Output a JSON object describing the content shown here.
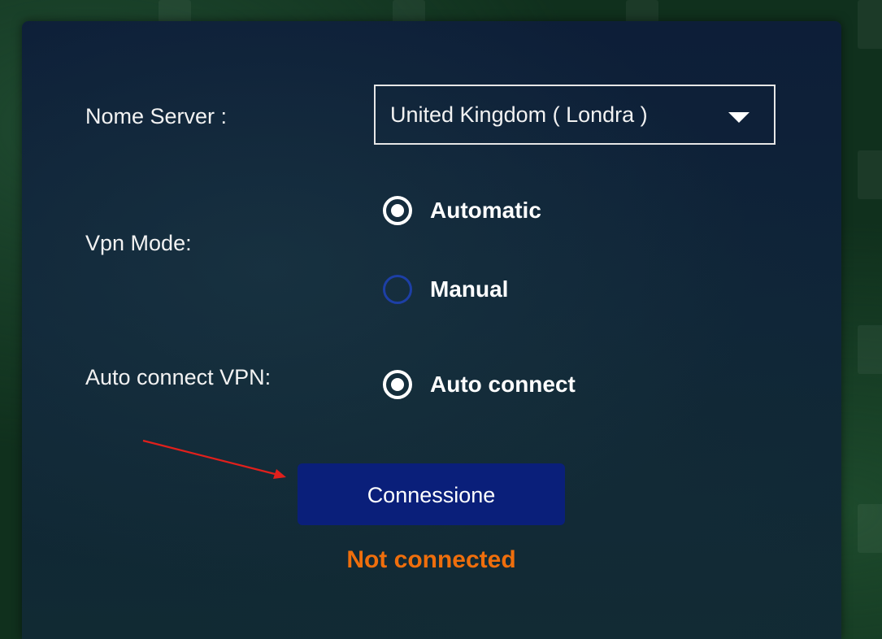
{
  "settings": {
    "server": {
      "label": "Nome Server :",
      "selected_value": "United Kingdom ( Londra )",
      "dropdown_icon": "caret-down-icon"
    },
    "vpn_mode": {
      "label": "Vpn Mode:",
      "options": [
        {
          "label": "Automatic",
          "checked": true
        },
        {
          "label": "Manual",
          "checked": false
        }
      ]
    },
    "auto_connect": {
      "label": "Auto connect VPN:",
      "option": {
        "label": "Auto connect",
        "checked": true
      }
    }
  },
  "actions": {
    "connect_label": "Connessione"
  },
  "status": {
    "text": "Not connected",
    "color": "#ef6e0c"
  },
  "colors": {
    "button_bg": "#0a1f7a",
    "radio_unchecked_ring": "#1d3fa6",
    "annotation_arrow": "#e0201c"
  }
}
